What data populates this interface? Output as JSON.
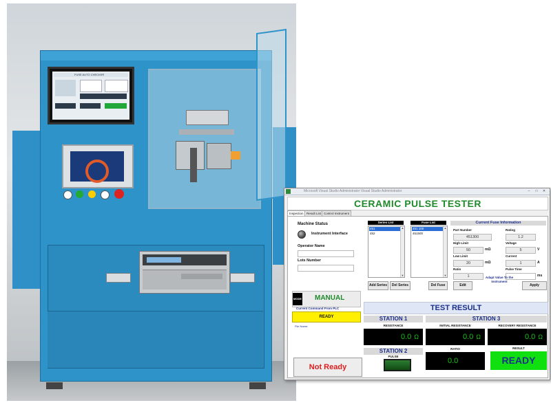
{
  "photo": {
    "monitor_title": "FUSE AUTO CHECKER"
  },
  "app": {
    "window_title": "Microsoft Visual Studio Administrator Visual Studio Administrator",
    "title": "CERAMIC PULSE TESTER",
    "tabs": [
      {
        "label": "Inspection",
        "active": true
      },
      {
        "label": "Result List",
        "active": false
      },
      {
        "label": "Control Instrument",
        "active": false
      }
    ],
    "machine_status": {
      "title": "Machine Status",
      "indicator_label": "Instrument Interface",
      "operator_label": "Operator Name",
      "operator_value": "",
      "lots_label": "Lots Number",
      "lots_value": ""
    },
    "mode": {
      "tag": "MODE",
      "value": "MANUAL",
      "plc_label": "Current Command From PLC",
      "plc_value": "READY",
      "file_name_label": "File Name:"
    },
    "status_button": "Not Ready",
    "series": {
      "header": "Series List",
      "items": [
        {
          "label": "451",
          "selected": true
        },
        {
          "label": "452",
          "selected": false
        }
      ],
      "add_label": "Add Series",
      "del_label": "Del Series"
    },
    "fuse": {
      "header": "Fuse List",
      "items": [
        {
          "label": "451 100",
          "selected": true
        },
        {
          "label": "451500",
          "selected": false
        }
      ],
      "del_label": "Del Fuse"
    },
    "fuse_info": {
      "header": "Current Fuse Information",
      "part_number_label": "Part Number",
      "part_number": "451300",
      "rating_label": "Rating",
      "rating": "1.2",
      "high_limit_label": "High Limit",
      "high_limit": "50",
      "high_limit_unit": "mΩ",
      "voltage_label": "Voltage",
      "voltage": "5",
      "voltage_unit": "V",
      "low_limit_label": "Low Limit",
      "low_limit": "20",
      "low_limit_unit": "mΩ",
      "current_label": "Current",
      "current": "1",
      "current_unit": "A",
      "ratio_label": "Ratio",
      "ratio": "1",
      "pulse_time_label": "Pulse Time",
      "pulse_time": "",
      "pulse_time_unit": "ms",
      "edit_label": "Edit",
      "adapt_label": "Adapt Value To the Instrument",
      "apply_label": "Apply"
    },
    "test_result": {
      "header": "TEST RESULT",
      "station1": {
        "title": "STATION 1",
        "resistance_label": "RESISTANCE",
        "resistance_value": "0.0",
        "unit": "Ω"
      },
      "station3": {
        "title": "STATION 3",
        "initial_label": "INITIAL RESISTANCE",
        "initial_value": "0.0",
        "recovery_label": "RECOVERY RESISTANCE",
        "recovery_value": "0.0",
        "unit": "Ω",
        "ratio_label": "RATIO",
        "ratio_value": "0.0",
        "result_label": "RESULT",
        "result_value": "READY"
      },
      "station2": {
        "title": "STATION 2",
        "pulse_label": "PULSE"
      }
    },
    "colors": {
      "title_green": "#1f8a2a",
      "navy": "#1c2f8a",
      "readout_green": "#19c219",
      "plc_yellow": "#ffef00",
      "ready_green": "#10e010",
      "not_ready_red": "#e01c1c"
    }
  }
}
